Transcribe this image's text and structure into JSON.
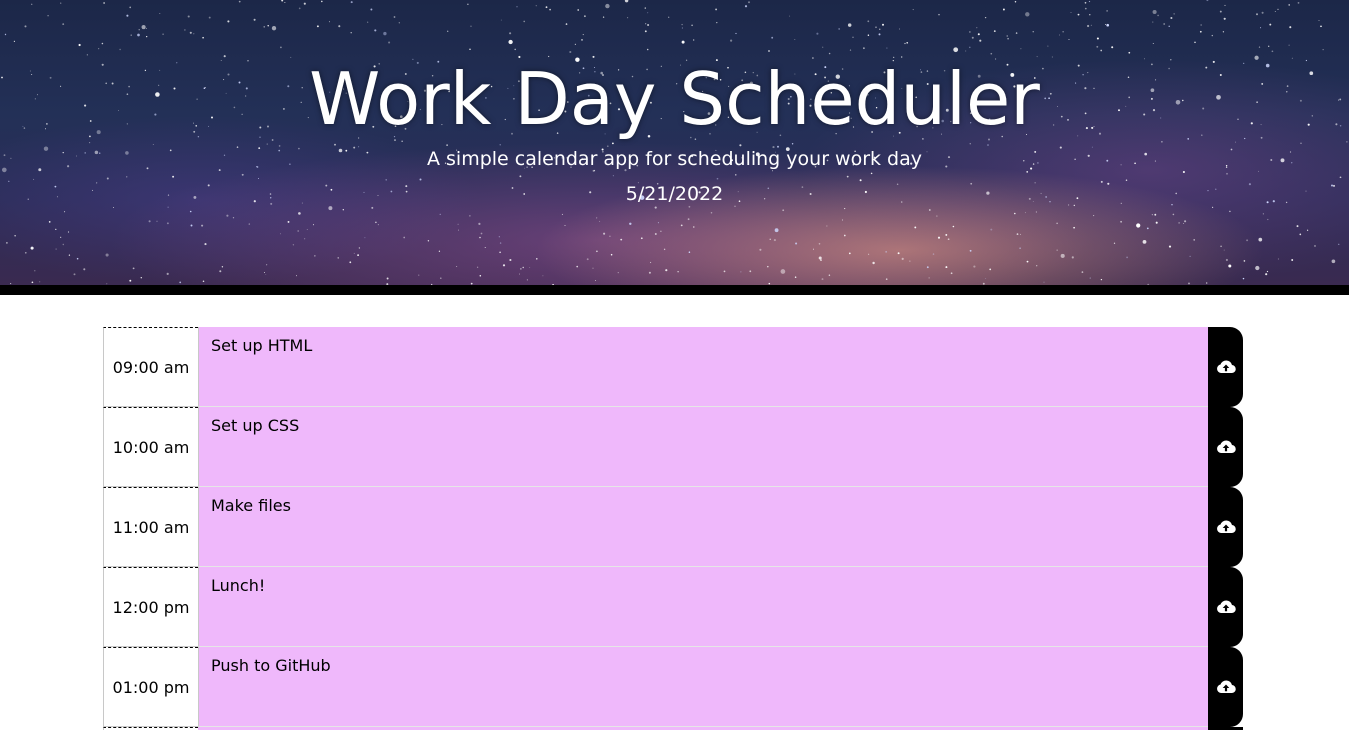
{
  "header": {
    "title": "Work Day Scheduler",
    "subtitle": "A simple calendar app for scheduling your work day",
    "date": "5/21/2022"
  },
  "colors": {
    "future_block": "#efb8fb",
    "save_button": "#000000",
    "header_text": "#ffffff"
  },
  "save_icon": "cloud-upload-icon",
  "time_blocks": [
    {
      "hour": "09:00 am",
      "task": "Set up HTML"
    },
    {
      "hour": "10:00 am",
      "task": "Set up CSS"
    },
    {
      "hour": "11:00 am",
      "task": "Make files"
    },
    {
      "hour": "12:00 pm",
      "task": "Lunch!"
    },
    {
      "hour": "01:00 pm",
      "task": "Push to GitHub"
    }
  ]
}
